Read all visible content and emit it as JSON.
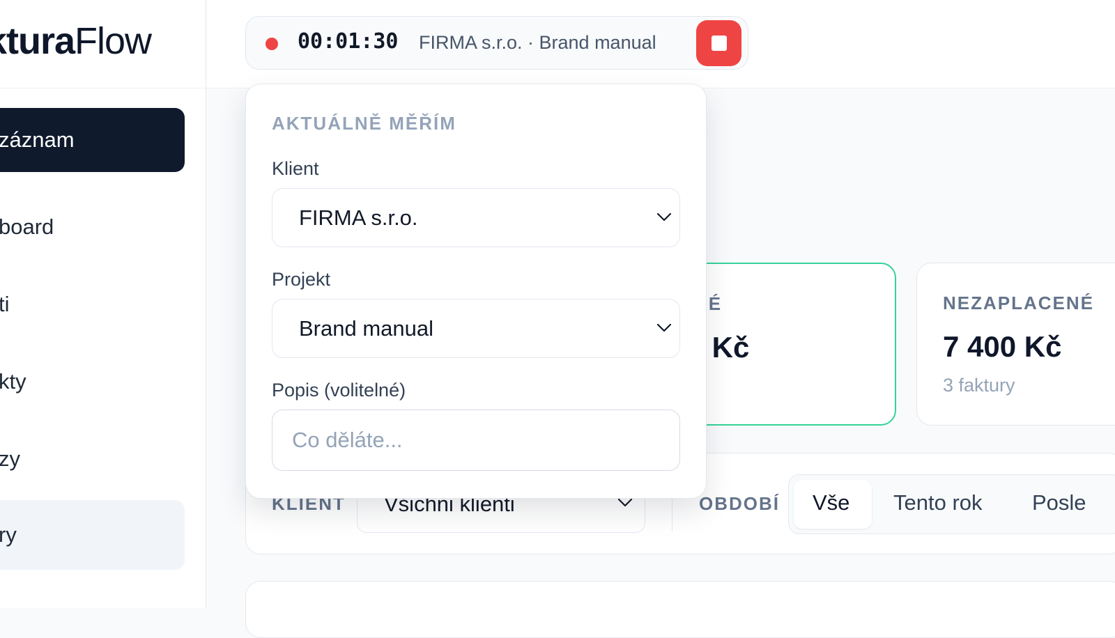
{
  "app": {
    "logo_bold": "ktura",
    "logo_light": "Flow"
  },
  "sidebar": {
    "items": [
      {
        "label": "záznam"
      },
      {
        "label": "board"
      },
      {
        "label": "ti"
      },
      {
        "label": "kty"
      },
      {
        "label": "zy"
      },
      {
        "label": "ry"
      }
    ]
  },
  "timer": {
    "elapsed": "00:01:30",
    "context": "FIRMA s.r.o. · Brand manual",
    "status_color": "#ef4444"
  },
  "stats": {
    "card1": {
      "title": "NÉ",
      "value": ") Kč"
    },
    "card2": {
      "title": "NEZAPLACENÉ",
      "value": "7 400 Kč",
      "sub": "3 faktury"
    }
  },
  "filters": {
    "client_label": "KLIENT",
    "client_value": "Všichni klienti",
    "period_label": "OBDOBÍ",
    "period_options": [
      "Vše",
      "Tento rok",
      "Posle"
    ],
    "period_selected": "Vše"
  },
  "popover": {
    "title": "AKTUÁLNĚ MĚŘÍM",
    "client_label": "Klient",
    "client_value": "FIRMA s.r.o.",
    "project_label": "Projekt",
    "project_value": "Brand manual",
    "description_label": "Popis (volitelné)",
    "description_placeholder": "Co děláte..."
  }
}
